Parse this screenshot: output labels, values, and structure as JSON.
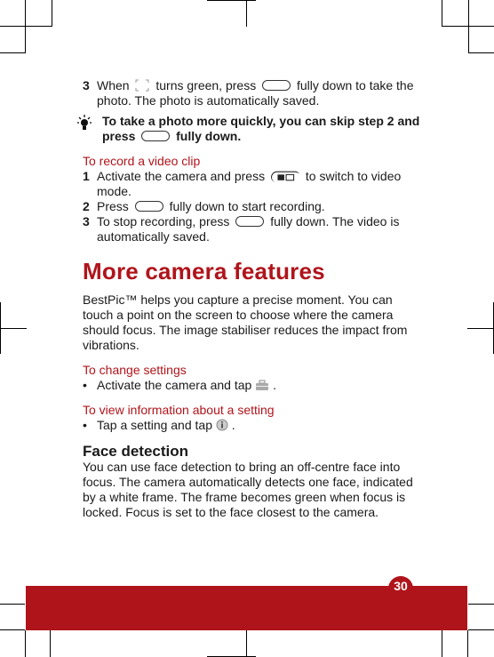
{
  "steps_photo": [
    {
      "num": "3",
      "before": "When",
      "middle": "turns green, press",
      "after": "fully down to take the photo. The photo is automatically saved.",
      "icons": [
        "focus-frame-icon",
        "camera-key-icon"
      ]
    }
  ],
  "tip": {
    "icon": "lightbulb-icon",
    "before": "To take a photo more quickly, you can skip step 2 and press",
    "after": "fully down."
  },
  "record_video": {
    "heading": "To record a video clip",
    "steps": [
      {
        "num": "1",
        "before": "Activate the camera and press",
        "after": "to switch to video mode.",
        "icon": "camera-video-switch-icon"
      },
      {
        "num": "2",
        "before": "Press",
        "after": "fully down to start recording.",
        "icon": "camera-key-icon"
      },
      {
        "num": "3",
        "before": "To stop recording, press",
        "after": "fully down. The video is automatically saved.",
        "icon": "camera-key-icon"
      }
    ]
  },
  "section": {
    "title": "More camera features",
    "intro": "BestPic™ helps you capture a precise moment. You can touch a point on the screen to choose where the camera should focus. The image stabiliser reduces the impact from vibrations."
  },
  "change_settings": {
    "heading": "To change settings",
    "bullet_before": "Activate the camera and tap",
    "bullet_after": ".",
    "icon": "settings-toolbox-icon"
  },
  "view_info": {
    "heading": "To view information about a setting",
    "bullet_before": "Tap a setting and tap",
    "bullet_after": ".",
    "icon": "info-icon"
  },
  "face_detection": {
    "title": "Face detection",
    "body": "You can use face detection to bring an off-centre face into focus. The camera automatically detects one face, indicated by a white frame. The frame becomes green when focus is locked. Focus is set to the face closest to the camera."
  },
  "footer": {
    "page_number": "30"
  },
  "colors": {
    "accent": "#b0141b",
    "text": "#1a1a1a"
  }
}
